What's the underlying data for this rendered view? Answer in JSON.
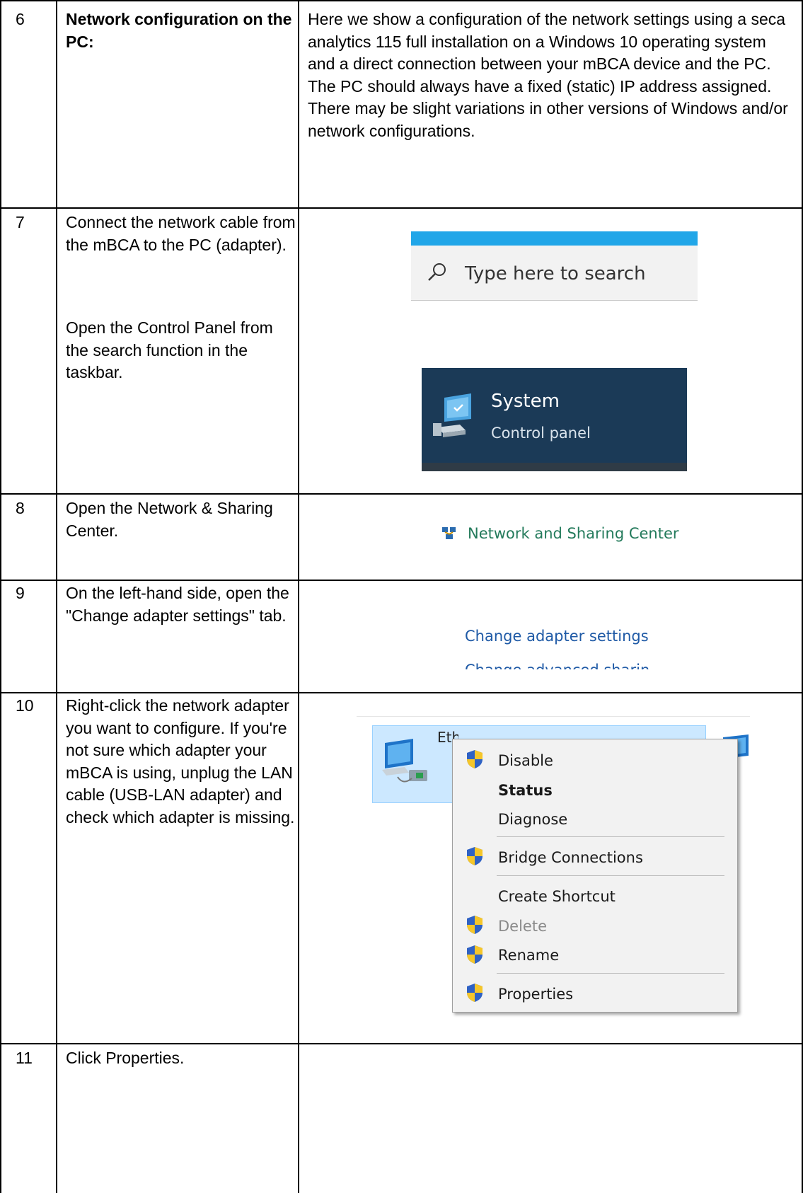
{
  "rows": [
    {
      "number": "6",
      "step": "Network configuration on the PC:",
      "description": "Here we show a configuration of the network settings using a seca analytics 115 full installation on a Windows 10 operating system and a direct connection between your mBCA device and the PC. The PC should always have a fixed (static) IP address assigned. There may be slight variations in other versions of Windows and/or network configurations."
    },
    {
      "number": "7",
      "step": "Connect the network cable from the mBCA to the PC (adapter).",
      "step_extra": "Open the Control Panel from the search function in the taskbar.",
      "search_placeholder": "Type here to search",
      "result_title": "System",
      "result_subtitle": "Control panel"
    },
    {
      "number": "8",
      "step": "Open the Network & Sharing Center.",
      "link": "Network and Sharing Center"
    },
    {
      "number": "9",
      "step": "On the left-hand side, open the \"Change adapter settings\" tab.",
      "link": "Change adapter settings",
      "link_cut": "Change advanced sharing"
    },
    {
      "number": "10",
      "step": "Right-click the network adapter you want to configure. If you're not sure which adapter your mBCA is using, unplug the LAN cable (USB-LAN adapter) and check which adapter is missing.",
      "adapter_name": "Ethernet",
      "menu": {
        "disable": "Disable",
        "status": "Status",
        "diagnose": "Diagnose",
        "bridge": "Bridge Connections",
        "shortcut": "Create Shortcut",
        "delete": "Delete",
        "rename": "Rename",
        "properties": "Properties"
      }
    },
    {
      "number": "11",
      "step": "Click Properties."
    }
  ],
  "colors": {
    "search_accent": "#21a6e8",
    "tile_bg": "#1b3a57",
    "link_green": "#237a5b",
    "link_blue": "#1f5aa6",
    "selection": "#cce8ff"
  }
}
